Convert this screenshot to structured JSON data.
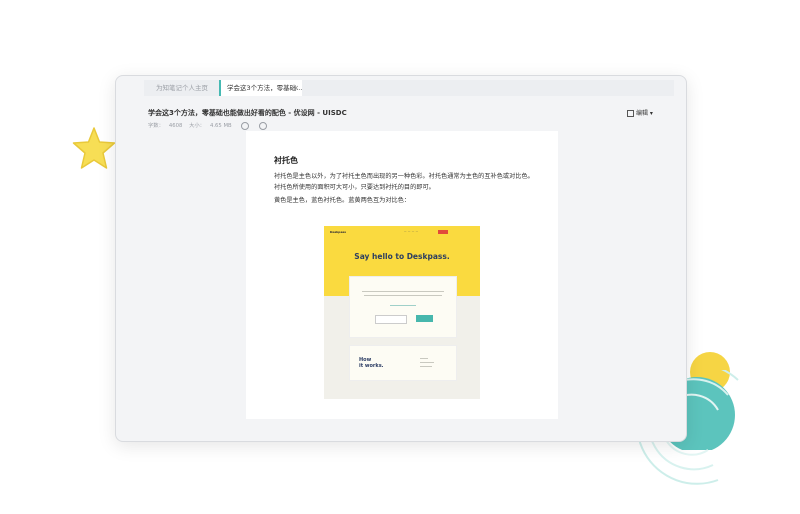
{
  "tabs": [
    {
      "label": "为知笔记个人主页"
    },
    {
      "label": "学会这3个方法，零基础..."
    }
  ],
  "document": {
    "title": "学会这3个方法，零基础也能做出好看的配色 - 优设网 - UISDC",
    "word_count_label": "字数：",
    "word_count": "4608",
    "size_label": "大小：",
    "size": "4.65 MB"
  },
  "toolbar": {
    "edit_label": "编辑"
  },
  "content": {
    "heading": "衬托色",
    "paragraph1": "衬托色是主色以外，为了衬托主色而出现的另一种色彩。衬托色通常为主色的互补色或对比色。衬托色所使用的面积可大可小，只要达到衬托的目的即可。",
    "paragraph2": "黄色是主色，蓝色衬托色。蓝黄两色互为对比色："
  },
  "embed": {
    "brand": "Deskpass",
    "hero": "Say hello to Deskpass.",
    "how_line1": "How",
    "how_line2": "it works."
  },
  "colors": {
    "accent": "#46b9b3",
    "embed_yellow": "#fada3f",
    "embed_teal": "#47b7ad"
  },
  "icons": [
    "star-icon",
    "close-icon",
    "edit-icon",
    "info-icon",
    "add-icon"
  ]
}
